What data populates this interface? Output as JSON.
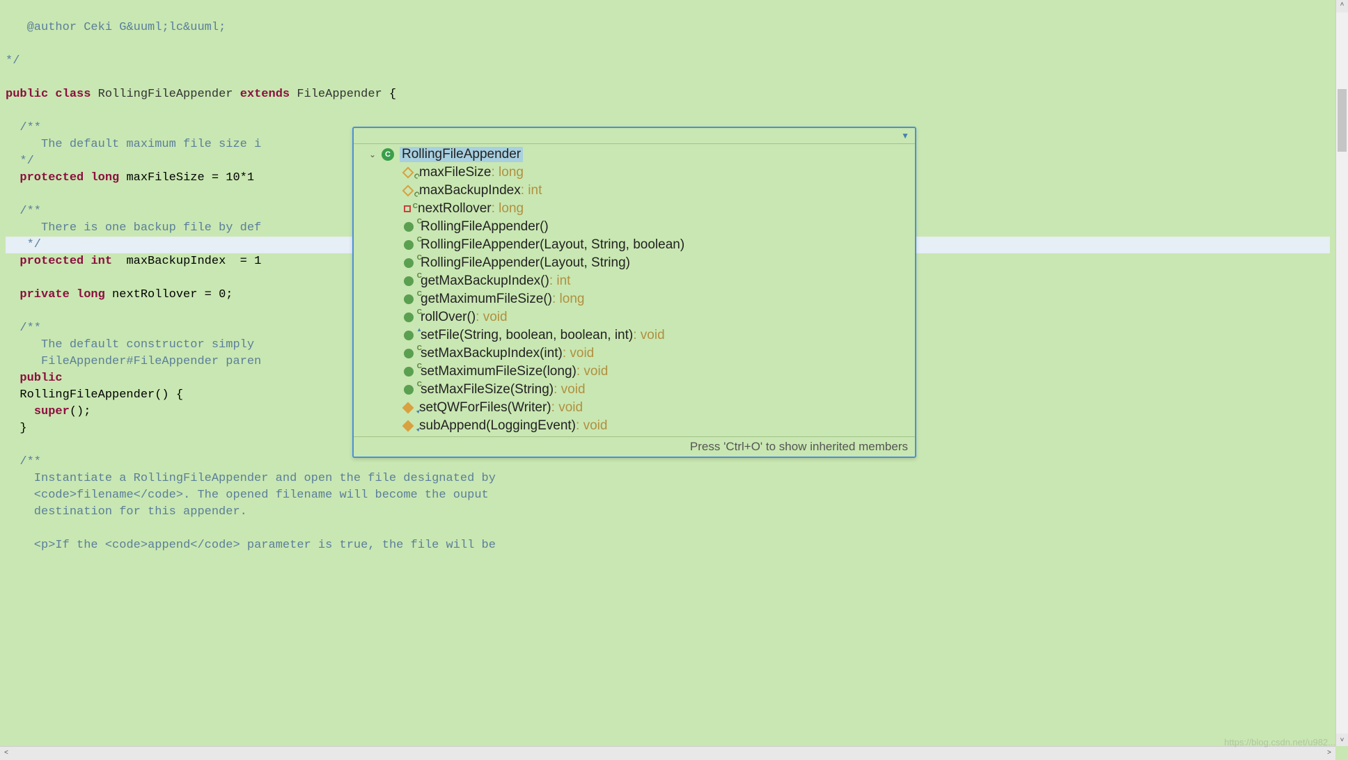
{
  "editor": {
    "author_tag": "@author",
    "author_name": " Ceki G&uuml;lc&uuml;",
    "end_comment": "*/",
    "kw_public": "public",
    "kw_class": "class",
    "classname": "RollingFileAppender",
    "kw_extends": "extends",
    "superclass": "FileAppender",
    "brace": " {",
    "c1_open": "  /**",
    "c1_line": "     The default maximum file size i",
    "c1_close": "  */",
    "kw_protected": "protected",
    "kw_long": "long",
    "f1_name": " maxFileSize = 10*1",
    "c2_open": "  /**",
    "c2_line": "     There is one backup file by def",
    "c2_close": "   */",
    "kw_int": "int",
    "f2_name": "  maxBackupIndex  = 1",
    "kw_private": "private",
    "f3_name": " nextRollover = 0;",
    "c3_open": "  /**",
    "c3_l1": "     The default constructor simply ",
    "c3_l2": "     FileAppender#FileAppender paren",
    "ctor_decl": "  RollingFileAppender() {",
    "kw_super": "super",
    "ctor_call": "();",
    "ctor_close": "  }",
    "c4_open": "  /**",
    "c4_l1": "    Instantiate a RollingFileAppender and open the file designated by",
    "c4_l2a": "    <code>",
    "c4_l2b": "filename",
    "c4_l2c": "</code>",
    "c4_l2d": ". The opened filename will become the ouput",
    "c4_l3": "    destination for this appender.",
    "c4_l4a": "    <p>",
    "c4_l4b": "If the ",
    "c4_l4c": "<code>",
    "c4_l4d": "append",
    "c4_l4e": "</code>",
    "c4_l4f": " parameter is true, the file will be"
  },
  "outline": {
    "root": "RollingFileAppender",
    "items": [
      {
        "icon": "diamond-hollow",
        "name": "maxFileSize",
        "sep": " : ",
        "type": "long"
      },
      {
        "icon": "diamond-hollow",
        "name": "maxBackupIndex",
        "sep": " : ",
        "type": "int"
      },
      {
        "icon": "square-hollow",
        "name": "nextRollover",
        "sep": " : ",
        "type": "long"
      },
      {
        "icon": "circle-green",
        "constructor": true,
        "name": "RollingFileAppender()",
        "sep": "",
        "type": ""
      },
      {
        "icon": "circle-green",
        "constructor": true,
        "name": "RollingFileAppender(Layout, String, boolean)",
        "sep": "",
        "type": ""
      },
      {
        "icon": "circle-green",
        "constructor": true,
        "name": "RollingFileAppender(Layout, String)",
        "sep": "",
        "type": ""
      },
      {
        "icon": "circle-green",
        "name": "getMaxBackupIndex()",
        "sep": " : ",
        "type": "int"
      },
      {
        "icon": "circle-green",
        "name": "getMaximumFileSize()",
        "sep": " : ",
        "type": "long"
      },
      {
        "icon": "circle-green",
        "name": "rollOver()",
        "sep": " : ",
        "type": "void"
      },
      {
        "icon": "circle-green",
        "override": true,
        "name": "setFile(String, boolean, boolean, int)",
        "sep": " : ",
        "type": "void"
      },
      {
        "icon": "circle-green",
        "name": "setMaxBackupIndex(int)",
        "sep": " : ",
        "type": "void"
      },
      {
        "icon": "circle-green",
        "name": "setMaximumFileSize(long)",
        "sep": " : ",
        "type": "void"
      },
      {
        "icon": "circle-green",
        "name": "setMaxFileSize(String)",
        "sep": " : ",
        "type": "void"
      },
      {
        "icon": "diamond-solid",
        "override": true,
        "name": "setQWForFiles(Writer)",
        "sep": " : ",
        "type": "void"
      },
      {
        "icon": "diamond-solid",
        "override": true,
        "name": "subAppend(LoggingEvent)",
        "sep": " : ",
        "type": "void"
      }
    ],
    "footer": "Press 'Ctrl+O' to show inherited members"
  },
  "watermark": "https://blog.csdn.net/u982..."
}
